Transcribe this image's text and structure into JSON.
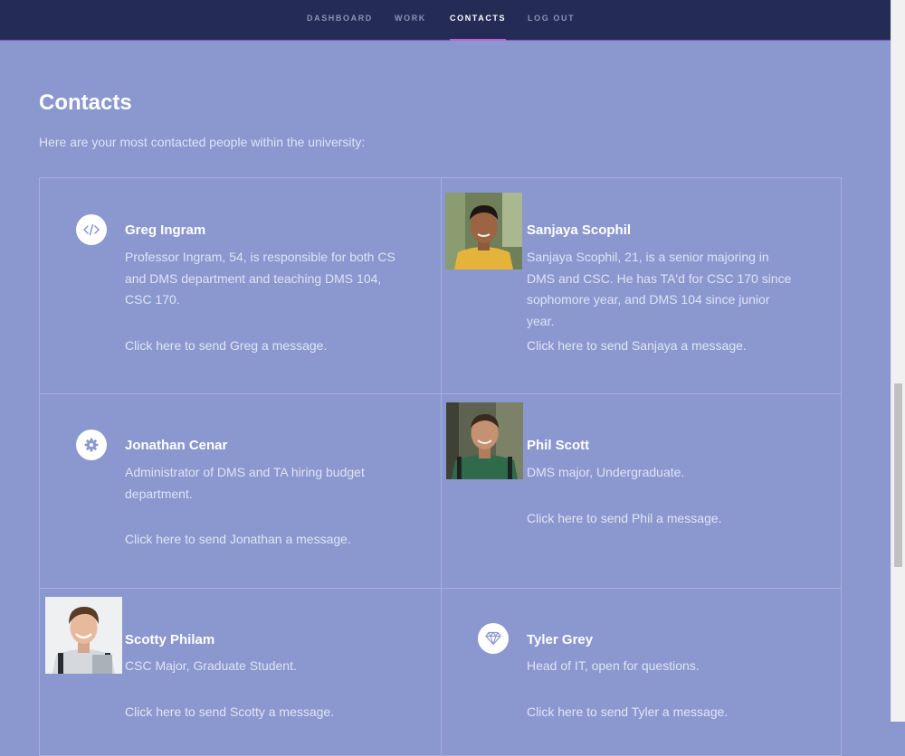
{
  "nav": {
    "items": [
      {
        "label": "DASHBOARD"
      },
      {
        "label": "WORK"
      },
      {
        "label": "CONTACTS"
      },
      {
        "label": "LOG OUT"
      }
    ]
  },
  "page": {
    "title": "Contacts",
    "intro": "Here are your most contacted people within the university:"
  },
  "contacts": [
    {
      "name": "Greg Ingram",
      "avatar": "code-icon",
      "description": "Professor Ingram, 54, is responsible for both CS and DMS department and teaching DMS 104, CSC 170.",
      "link": "Click here to send Greg a message."
    },
    {
      "name": "Sanjaya Scophil",
      "avatar": "photo",
      "description": "Sanjaya Scophil, 21, is a senior majoring in DMS and CSC. He has TA'd for CSC 170 since sophomore year, and DMS 104 since junior year.",
      "link": "Click here to send Sanjaya a message."
    },
    {
      "name": "Jonathan Cenar",
      "avatar": "gear-icon",
      "description": "Administrator of DMS and TA hiring budget department.",
      "link": "Click here to send Jonathan a message."
    },
    {
      "name": "Phil Scott",
      "avatar": "photo",
      "description": "DMS major, Undergraduate.",
      "link": "Click here to send Phil a message."
    },
    {
      "name": "Scotty Philam",
      "avatar": "photo",
      "description": "CSC Major, Graduate Student.",
      "link": "Click here to send Scotty a message."
    },
    {
      "name": "Tyler Grey",
      "avatar": "diamond-icon",
      "description": "Head of IT, open for questions.",
      "link": "Click here to send Tyler a message."
    }
  ],
  "colors": {
    "page_background": "#8a98cf",
    "nav_background": "#242b55",
    "nav_active_underline": "#c15fd6",
    "grid_line": "#a6b0de",
    "text_white": "#ffffff",
    "text_muted": "#dfe3f4"
  }
}
